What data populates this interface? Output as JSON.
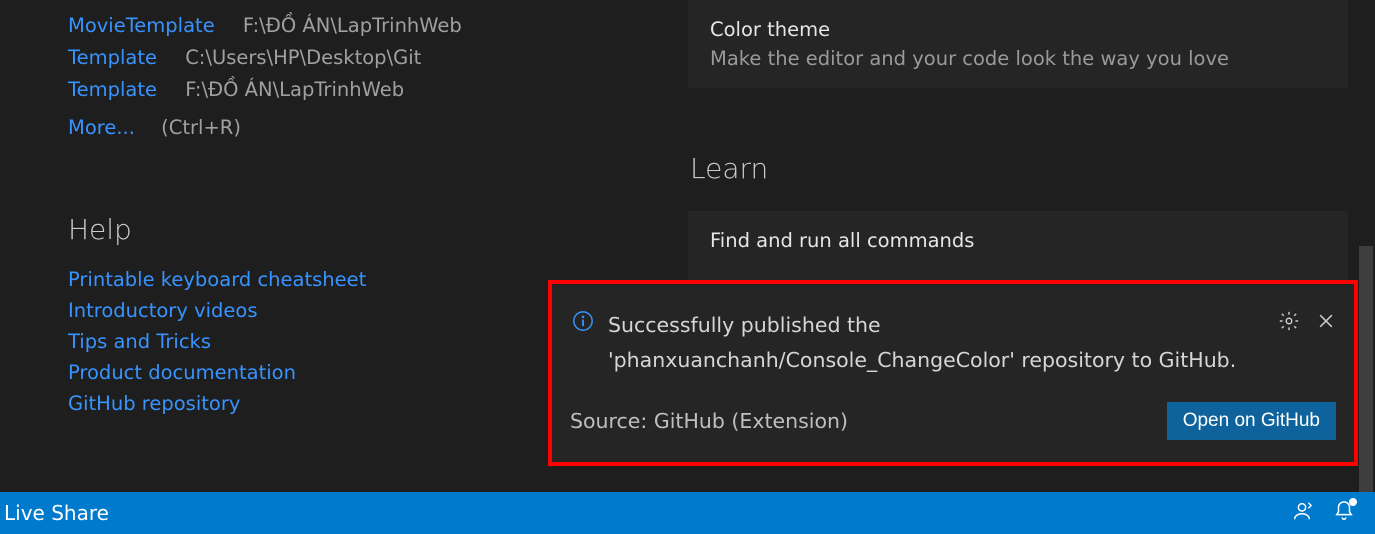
{
  "recent": [
    {
      "name": "MovieTemplate",
      "path": "F:\\ĐỒ ÁN\\LapTrinhWeb"
    },
    {
      "name": "Template",
      "path": "C:\\Users\\HP\\Desktop\\Git"
    },
    {
      "name": "Template",
      "path": "F:\\ĐỒ ÁN\\LapTrinhWeb"
    }
  ],
  "more": {
    "label": "More...",
    "shortcut": "(Ctrl+R)"
  },
  "help": {
    "title": "Help",
    "links": [
      "Printable keyboard cheatsheet",
      "Introductory videos",
      "Tips and Tricks",
      "Product documentation",
      "GitHub repository"
    ]
  },
  "right": {
    "card1": {
      "title": "Color theme",
      "sub": "Make the editor and your code look the way you love"
    },
    "learn_title": "Learn",
    "card2": {
      "title": "Find and run all commands"
    }
  },
  "notification": {
    "message": "Successfully published the 'phanxuanchanh/Console_ChangeColor' repository to GitHub.",
    "source": "Source: GitHub (Extension)",
    "action": "Open on GitHub"
  },
  "statusbar": {
    "liveshare": "Live Share"
  }
}
